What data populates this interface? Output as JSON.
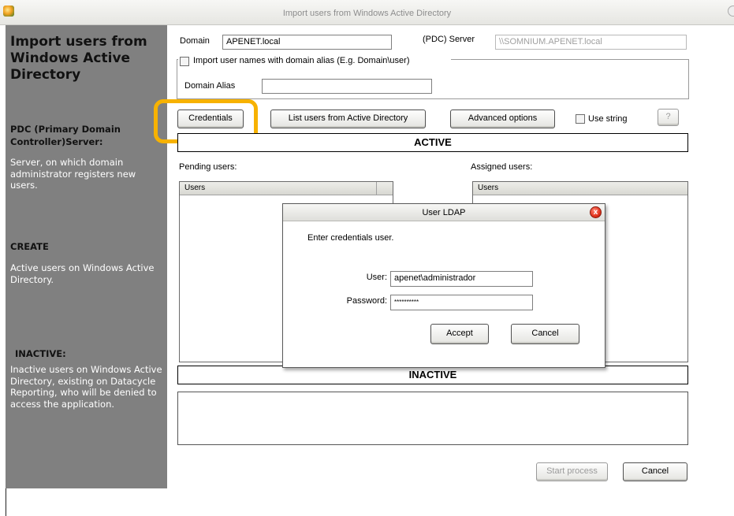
{
  "window": {
    "title": "Import users from Windows Active Directory"
  },
  "left_panel": {
    "title": "Import users from Windows Active Directory",
    "pdc_header": "PDC (Primary Domain Controller)Server:",
    "pdc_text": "Server, on which domain administrator registers new users.",
    "create_header": "CREATE",
    "create_text": "Active users on Windows Active Directory.",
    "inactive_header": "INACTIVE:",
    "inactive_text": "Inactive users on Windows Active Directory, existing on Datacycle Reporting, who will be denied to access the application."
  },
  "form": {
    "domain_label": "Domain",
    "domain_value": "APENET.local",
    "server_label": "(PDC) Server",
    "server_value": "\\\\SOMNIUM.APENET.local",
    "alias_checkbox_label": "Import user names with domain alias (E.g. Domain\\user)",
    "alias_checked": false,
    "domain_alias_label": "Domain Alias",
    "domain_alias_value": ""
  },
  "toolbar": {
    "credentials": "Credentials",
    "list_users": "List users from Active Directory",
    "advanced": "Advanced options",
    "use_string": "Use string",
    "use_string_checked": false,
    "help": "?"
  },
  "active_banner": "ACTIVE",
  "inactive_banner": "INACTIVE",
  "pending_label": "Pending users:",
  "assigned_label": "Assigned users:",
  "pending_column": "Users",
  "assigned_column": "Users",
  "footer": {
    "start_process": "Start process",
    "cancel": "Cancel"
  },
  "dialog": {
    "title": "User LDAP",
    "close": "x",
    "prompt": "Enter credentials user.",
    "user_label": "User:",
    "user_value": "apenet\\administrador",
    "password_label": "Password:",
    "password_value": "**********",
    "accept": "Accept",
    "cancel": "Cancel"
  },
  "colors": {
    "highlight": "#f7b200",
    "left_panel": "#808080"
  }
}
